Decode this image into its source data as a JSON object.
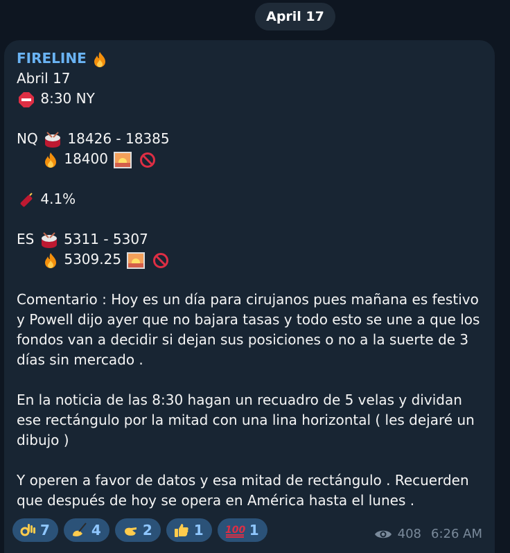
{
  "date_pill": "April 17",
  "message": {
    "sender": "FIRELINE",
    "l_date": "Abril 17",
    "l_time": "8:30 NY",
    "nq_label": "NQ",
    "nq_range": "18426 - 18385",
    "nq_target": "18400",
    "pct": "4.1%",
    "es_label": "ES",
    "es_range": "5311 - 5307",
    "es_target": "5309.25",
    "para1": "Comentario : Hoy es un día para cirujanos pues mañana es festivo y Powell dijo ayer que no bajara tasas y todo esto se une a que los fondos van a decidir si dejan sus posiciones o no a la suerte de 3 días sin mercado .",
    "para2": "En la noticia de las 8:30 hagan un recuadro de 5 velas y dividan ese rectángulo por la mitad con una lina horizontal ( les dejaré un dibujo )",
    "para3": "Y operen a favor de datos y esa mitad de rectángulo . Recuerden que después de hoy se opera en América hasta el lunes ."
  },
  "reactions": [
    {
      "icon": "ok-hand-icon",
      "count": "7"
    },
    {
      "icon": "writing-hand-icon",
      "count": "4"
    },
    {
      "icon": "pinching-hand-icon",
      "count": "2"
    },
    {
      "icon": "thumbs-up-icon",
      "count": "1"
    },
    {
      "icon": "hundred-points-icon",
      "count": "1"
    }
  ],
  "meta": {
    "views": "408",
    "time": "6:26 AM"
  },
  "colors": {
    "background": "#0e1621",
    "bubble": "#182533",
    "sender": "#6ab3f3",
    "reaction": "#2b5278"
  }
}
